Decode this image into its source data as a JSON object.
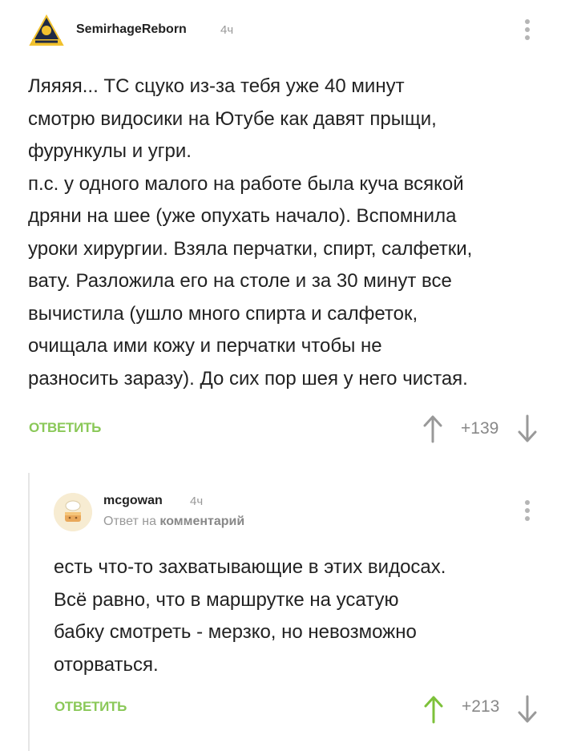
{
  "comments": [
    {
      "username": "SemirhageReborn",
      "time": "4ч",
      "lines": [
        "Ляяяя... ТС сцуко из-за тебя уже 40 минут",
        "смотрю видосики на Ютубе как давят прыщи,",
        "фурункулы и угри.",
        "п.с. у одного малого на работе была куча всякой",
        "дряни на шее (уже опухать начало). Вспомнила",
        "уроки хирургии. Взяла перчатки, спирт, салфетки,",
        "вату. Разложила его на столе и за 30 минут все",
        "вычистила (ушло много спирта и салфеток,",
        "очищала ими кожу и перчатки чтобы не",
        "разносить заразу). До сих пор шея у него чистая."
      ],
      "reply_label": "ОТВЕТИТЬ",
      "rating": "+139",
      "up_color": "#999999"
    },
    {
      "username": "mcgowan",
      "time": "4ч",
      "reply_prefix": "Ответ на",
      "reply_target": "комментарий",
      "lines": [
        "есть что-то захватывающие в этих видосах.",
        "Всё равно, что в маршрутке на усатую",
        "бабку смотреть - мерзко, но невозможно",
        "оторваться."
      ],
      "reply_label": "ОТВЕТИТЬ",
      "rating": "+213",
      "up_color": "#7dc13a"
    }
  ],
  "colors": {
    "accent": "#8ac858",
    "muted": "#999999"
  },
  "icons": [
    "more-icon",
    "upvote-icon",
    "downvote-icon"
  ]
}
